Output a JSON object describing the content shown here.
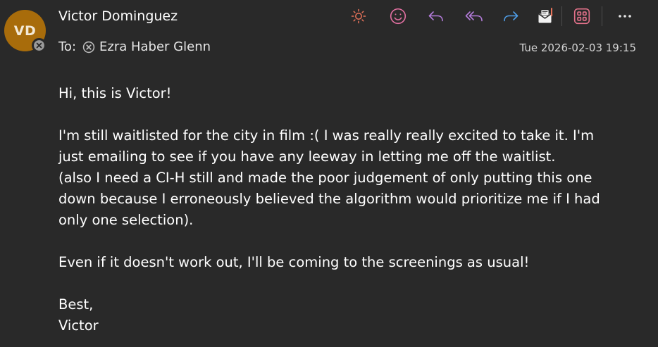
{
  "sender": {
    "initials": "VD",
    "name": "Victor Dominguez"
  },
  "recipients": {
    "label": "To:",
    "name": "Ezra Haber Glenn"
  },
  "timestamp": "Tue 2026-02-03 19:15",
  "toolbar": {
    "icons": [
      "sun-icon",
      "smiley-icon",
      "reply-icon",
      "reply-all-icon",
      "forward-icon",
      "envelope-note-icon",
      "apps-grid-icon",
      "more-icon"
    ],
    "colors": {
      "sun": "#e8735a",
      "smiley": "#e06fa0",
      "reply": "#b47cdb",
      "reply_all": "#b47cdb",
      "forward": "#4f9ee8",
      "apps": "#e3728a",
      "more": "#e6e6e6"
    }
  },
  "message": {
    "greeting": "Hi, this is Victor!",
    "paragraph1_line1": "I'm still waitlisted for the city in film :( I was really really excited to take it. I'm",
    "paragraph1_line2": "just emailing to see if you have any leeway in letting me off the waitlist.",
    "paragraph1_line3": "(also I need a CI-H still and made the poor judgement of only putting this one",
    "paragraph1_line4": "down because I erroneously believed the algorithm would prioritize me if I had",
    "paragraph1_line5": "only one selection).",
    "paragraph2": "Even if it doesn't work out, I'll be coming to the screenings as usual!",
    "signoff": "Best,",
    "signature": "Victor"
  }
}
